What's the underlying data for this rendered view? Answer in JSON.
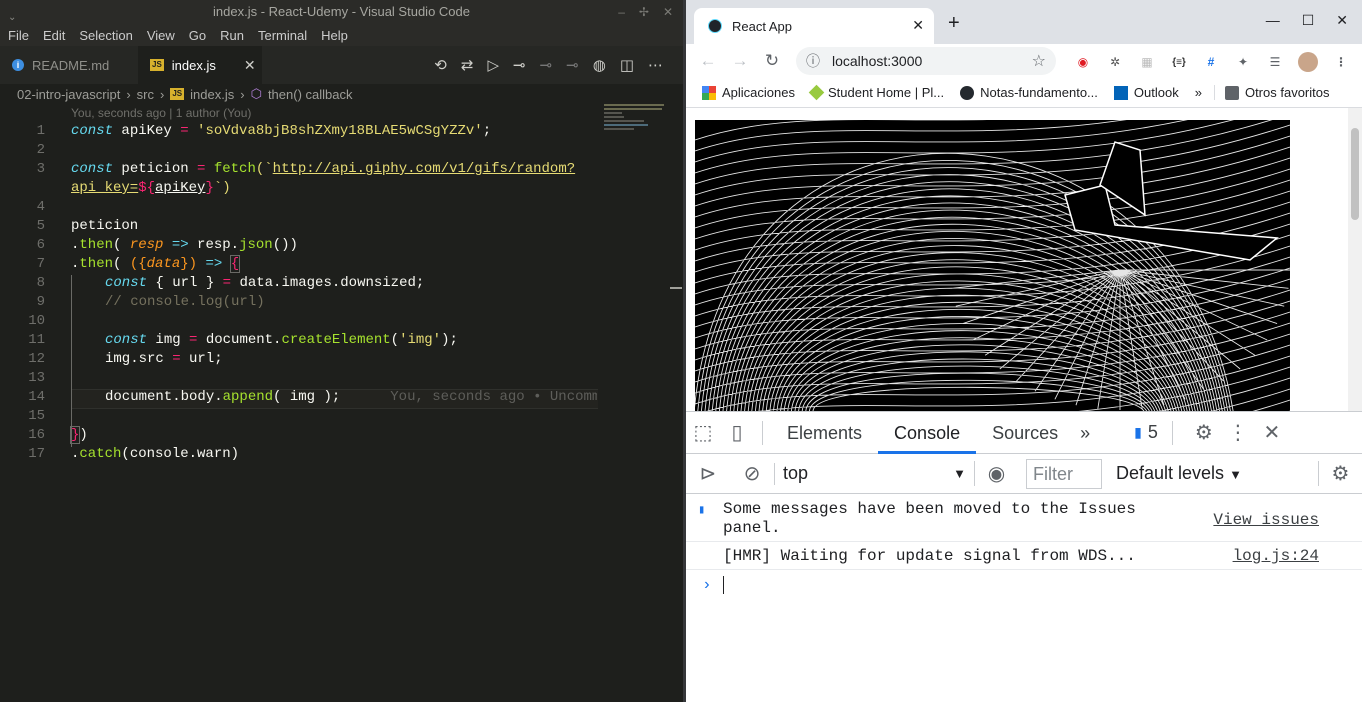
{
  "vscode": {
    "title": "index.js - React-Udemy - Visual Studio Code",
    "menu": [
      "File",
      "Edit",
      "Selection",
      "View",
      "Go",
      "Run",
      "Terminal",
      "Help"
    ],
    "tabs": [
      {
        "label": "README.md"
      },
      {
        "label": "index.js",
        "close": "✕"
      }
    ],
    "breadcrumb": {
      "folder": "02-intro-javascript",
      "sub": "src",
      "file": "index.js",
      "symbol": "then() callback"
    },
    "blame": "You, seconds ago | 1 author (You)",
    "line_numbers": [
      "1",
      "2",
      "3",
      "4",
      "5",
      "6",
      "7",
      "8",
      "9",
      "10",
      "11",
      "12",
      "13",
      "14",
      "15",
      "16",
      "17"
    ],
    "code": {
      "l1_kw": "const",
      "l1_name": " apiKey ",
      "l1_op": "=",
      "l1_str": " 'soVdva8bjB8shZXmy18BLAE5wCSgYZZv'",
      ";": ";",
      "l3_kw": "const",
      "l3_name": " peticion ",
      "l3_op": "=",
      "l3_fn": " fetch",
      "l3_a": "(`",
      "l3_url": "http://api.giphy.com/v1/gifs/random?",
      "l3b_url": "api_key=",
      "l3b_op": "${",
      "l3b_var": "apiKey",
      "l3b_op2": "}",
      "l3b_end": "`)",
      "l5": "peticion",
      "l6_a": ".",
      "l6_fn": "then",
      "l6_b": "( ",
      "l6_param": "resp",
      "l6_op": " =>",
      "l6_c": " resp.",
      "l6_fn2": "json",
      "l6_d": "())",
      "l7_a": ".",
      "l7_fn": "then",
      "l7_b": "( ",
      "l7_c": "({",
      "l7_param": "data",
      "l7_d": "})",
      "l7_op": " =>",
      "l7_e": " ",
      "l7_br": "{",
      "l8_kw": "const",
      "l8_a": " { url } ",
      "l8_op": "=",
      "l8_b": " data.images.downsized;",
      "l9": "// console.log(url)",
      "l11_kw": "const",
      "l11_a": " img ",
      "l11_op": "=",
      "l11_b": " document.",
      "l11_fn": "createElement",
      "l11_c": "(",
      "l11_str": "'img'",
      "l11_d": ");",
      "l12_a": "img.src ",
      "l12_op": "=",
      "l12_b": " url;",
      "l14_a": "document.body.",
      "l14_fn": "append",
      "l14_b": "( img );",
      "l14_ghost": "You, seconds ago • Uncommitted changes",
      "l16_br": "}",
      "l16_b": ")",
      "l17_a": ".",
      "l17_fn": "catch",
      "l17_b": "(console.warn)"
    }
  },
  "chrome": {
    "tab_title": "React App",
    "tab_close": "✕",
    "new_tab": "+",
    "url": "localhost:3000",
    "bookmarks": [
      "Aplicaciones",
      "Student Home | Pl...",
      "Notas-fundamento...",
      "Outlook"
    ],
    "bookmarks_more": "»",
    "other_bookmarks": "Otros favoritos"
  },
  "devtools": {
    "tabs": [
      "Elements",
      "Console",
      "Sources"
    ],
    "more": "»",
    "issues_count": "5",
    "context": "top",
    "filter_placeholder": "Filter",
    "levels": "Default levels",
    "messages": [
      {
        "text_line1": "Some messages have been moved to the Issues",
        "text_line2": "panel.",
        "link": "View issues"
      },
      {
        "text": "[HMR] Waiting for update signal from WDS...",
        "link": "log.js:24"
      }
    ],
    "prompt": "›"
  }
}
